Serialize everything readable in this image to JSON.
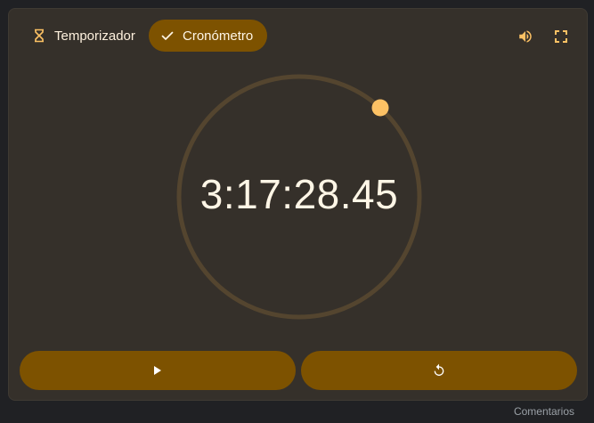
{
  "tabs": {
    "timer_label": "Temporizador",
    "stopwatch_label": "Cronómetro"
  },
  "stopwatch": {
    "display": "3:17:28.45"
  },
  "footer": {
    "feedback_label": "Comentarios"
  },
  "icons": {
    "timer_tab": "hourglass-icon",
    "stopwatch_tab": "check-icon",
    "sound": "volume-icon",
    "fullscreen": "fullscreen-icon",
    "play": "play-icon",
    "reset": "reset-icon"
  },
  "colors": {
    "card_background": "#35302a",
    "accent": "#7d5200",
    "dial_track": "#54452f",
    "dial_knob": "#fcc164",
    "icon": "#fcc164",
    "text": "#fff6e6"
  }
}
